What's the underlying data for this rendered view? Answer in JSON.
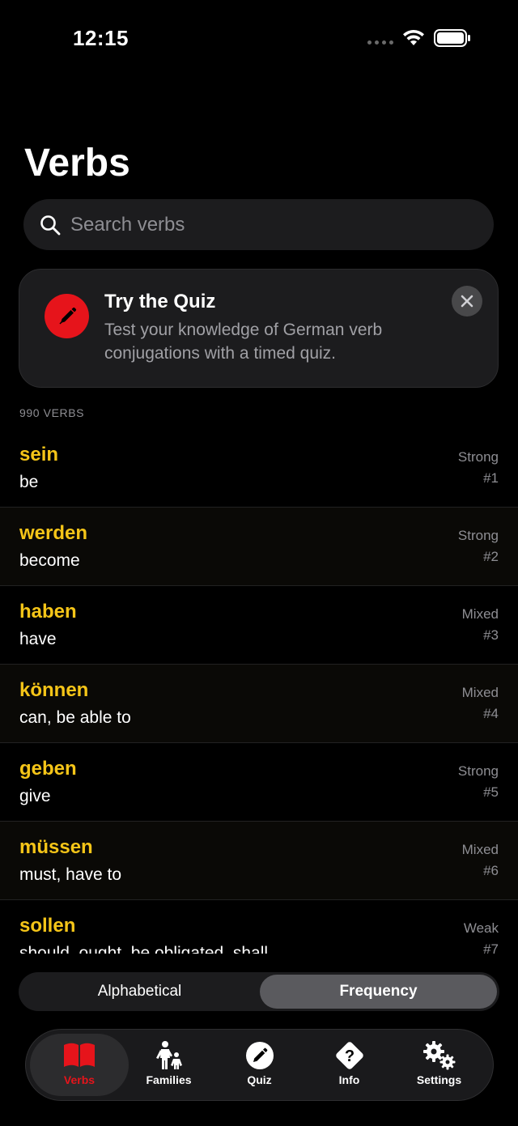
{
  "status": {
    "time": "12:15"
  },
  "header": {
    "title": "Verbs"
  },
  "search": {
    "placeholder": "Search verbs"
  },
  "quiz_card": {
    "title": "Try the Quiz",
    "description": "Test your knowledge of German verb conjugations with a timed quiz."
  },
  "list": {
    "count_label": "990 VERBS",
    "verbs": [
      {
        "name": "sein",
        "meaning": "be",
        "type": "Strong",
        "rank": "#1"
      },
      {
        "name": "werden",
        "meaning": "become",
        "type": "Strong",
        "rank": "#2"
      },
      {
        "name": "haben",
        "meaning": "have",
        "type": "Mixed",
        "rank": "#3"
      },
      {
        "name": "können",
        "meaning": "can, be able to",
        "type": "Mixed",
        "rank": "#4"
      },
      {
        "name": "geben",
        "meaning": "give",
        "type": "Strong",
        "rank": "#5"
      },
      {
        "name": "müssen",
        "meaning": "must, have to",
        "type": "Mixed",
        "rank": "#6"
      },
      {
        "name": "sollen",
        "meaning": "should, ought, be obligated, shall",
        "type": "Weak",
        "rank": "#7"
      }
    ]
  },
  "sort": {
    "alphabetical": "Alphabetical",
    "frequency": "Frequency",
    "selected": "Frequency"
  },
  "tabs": [
    {
      "label": "Verbs",
      "icon": "book-icon"
    },
    {
      "label": "Families",
      "icon": "family-icon"
    },
    {
      "label": "Quiz",
      "icon": "pencil-icon"
    },
    {
      "label": "Info",
      "icon": "question-icon"
    },
    {
      "label": "Settings",
      "icon": "gears-icon"
    }
  ],
  "colors": {
    "accent_red": "#e6141b",
    "verb_yellow": "#f5c518",
    "background": "#000000",
    "card": "#1c1c1e"
  }
}
